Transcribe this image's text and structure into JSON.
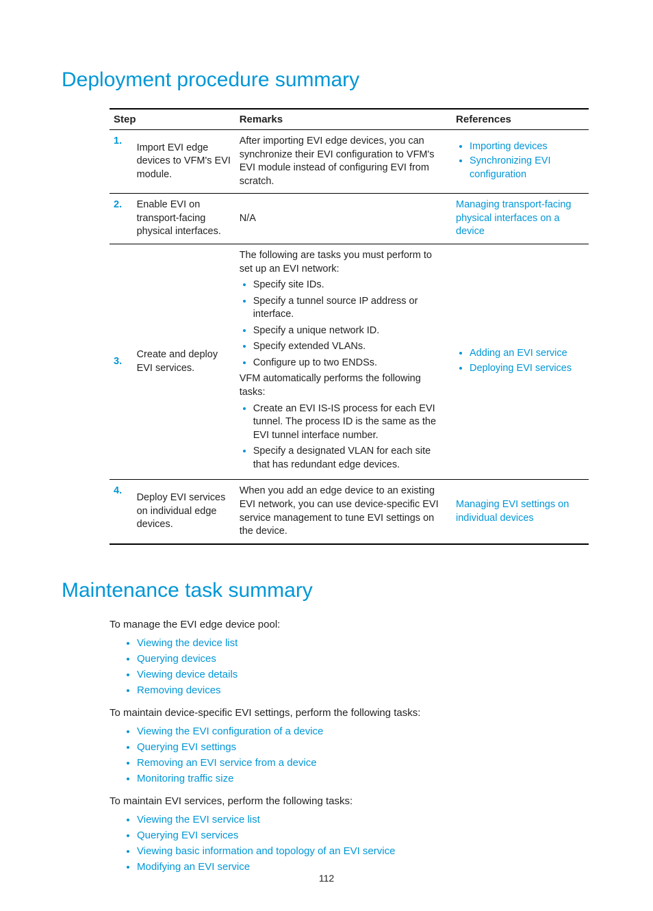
{
  "headings": {
    "h1a": "Deployment procedure summary",
    "h1b": "Maintenance task summary"
  },
  "table": {
    "headers": {
      "step": "Step",
      "remarks": "Remarks",
      "refs": "References"
    },
    "rows": {
      "r1": {
        "num": "1.",
        "step": "Import EVI edge devices to VFM's EVI module.",
        "remarks": "After importing EVI edge devices, you can synchronize their EVI configuration to VFM's EVI module instead of configuring EVI from scratch.",
        "refs": {
          "a": "Importing devices",
          "b": "Synchronizing EVI configuration"
        }
      },
      "r2": {
        "num": "2.",
        "step": "Enable EVI on transport-facing physical interfaces.",
        "remarks": "N/A",
        "refs": {
          "a": "Managing transport-facing physical interfaces on a device"
        }
      },
      "r3": {
        "num": "3.",
        "step": "Create and deploy EVI services.",
        "remarks_intro": "The following are tasks you must perform to set up an EVI network:",
        "remarks_list1": {
          "a": "Specify site IDs.",
          "b": "Specify a tunnel source IP address or interface.",
          "c": "Specify a unique network ID.",
          "d": "Specify extended VLANs.",
          "e": "Configure up to two ENDSs."
        },
        "remarks_mid": "VFM automatically performs the following tasks:",
        "remarks_list2": {
          "a": "Create an EVI IS-IS process for each EVI tunnel. The process ID is the same as the EVI tunnel interface number.",
          "b": "Specify a designated VLAN for each site that has redundant edge devices."
        },
        "refs": {
          "a": "Adding an EVI service",
          "b": "Deploying EVI services"
        }
      },
      "r4": {
        "num": "4.",
        "step": "Deploy EVI services on individual edge devices.",
        "remarks": "When you add an edge device to an existing EVI network, you can use device-specific EVI service management to tune EVI settings on the device.",
        "refs": {
          "a": "Managing EVI settings on individual devices"
        }
      }
    }
  },
  "maintenance": {
    "intro1": "To manage the EVI edge device pool:",
    "list1": {
      "a": "Viewing the device list",
      "b": "Querying devices",
      "c": "Viewing device details",
      "d": "Removing devices"
    },
    "intro2": "To maintain device-specific EVI settings, perform the following tasks:",
    "list2": {
      "a": "Viewing the EVI configuration of a device",
      "b": "Querying EVI settings",
      "c": "Removing an EVI service from a device",
      "d": "Monitoring traffic size"
    },
    "intro3": "To maintain EVI services, perform the following tasks:",
    "list3": {
      "a": "Viewing the EVI service list",
      "b": "Querying EVI services",
      "c": "Viewing basic information and topology of an EVI service",
      "d": "Modifying an EVI service"
    }
  },
  "page_number": "112"
}
